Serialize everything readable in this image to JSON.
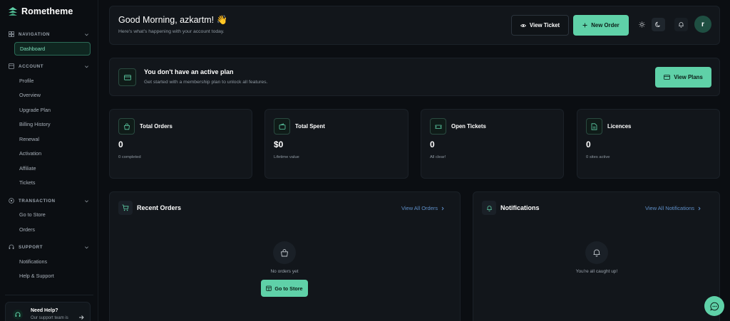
{
  "app": {
    "name": "Rometheme"
  },
  "sidebar": {
    "sections": [
      {
        "label": "Navigation",
        "icon": "grid-icon"
      },
      {
        "label": "Account",
        "icon": "account-icon"
      },
      {
        "label": "Transaction",
        "icon": "transaction-icon"
      },
      {
        "label": "Support",
        "icon": "support-icon"
      }
    ],
    "items": {
      "dashboard": "Dashboard",
      "profile": "Profile",
      "overview": "Overview",
      "upgrade_plan": "Upgrade Plan",
      "billing_history": "Billing History",
      "renewal": "Renewal",
      "activation": "Activation",
      "affiliate": "Affiliate",
      "tickets": "Tickets",
      "go_to_store": "Go to Store",
      "orders": "Orders",
      "notifications": "Notifications",
      "help_support": "Help & Support"
    },
    "help": {
      "title": "Need Help?",
      "subtitle": "Our support team is"
    }
  },
  "header": {
    "greeting": "Good Morning, azkartm! 👋",
    "subtitle": "Here's what's happening with your account today.",
    "view_ticket": "View Ticket",
    "new_order": "New Order",
    "avatar_initial": "r"
  },
  "plan": {
    "title": "You don't have an active plan",
    "subtitle": "Get started with a membership plan to unlock all features.",
    "button": "View Plans"
  },
  "stats": [
    {
      "label": "Total Orders",
      "value": "0",
      "sub": "0 completed",
      "icon": "bag-icon"
    },
    {
      "label": "Total Spent",
      "value": "$0",
      "sub": "Lifetime value",
      "icon": "wallet-icon"
    },
    {
      "label": "Open Tickets",
      "value": "0",
      "sub": "All clear!",
      "icon": "ticket-icon"
    },
    {
      "label": "Licences",
      "value": "0",
      "sub": "0 sites active",
      "icon": "document-icon"
    }
  ],
  "orders_panel": {
    "title": "Recent Orders",
    "link": "View All Orders",
    "empty": "No orders yet",
    "button": "Go to Store"
  },
  "notifications_panel": {
    "title": "Notifications",
    "link": "View All Notifications",
    "empty": "You're all caught up!"
  },
  "colors": {
    "accent": "#5fd1a8",
    "background": "#0b0e12",
    "card": "#12161b",
    "link": "#5f8fc8"
  }
}
